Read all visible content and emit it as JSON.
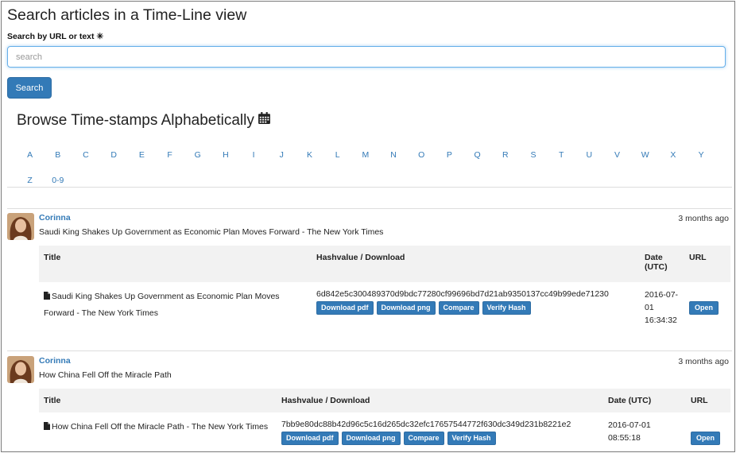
{
  "page_title": "Search articles in a Time-Line view",
  "search": {
    "label": "Search by URL or text ✳",
    "placeholder": "search",
    "value": "",
    "button_label": "Search"
  },
  "browse": {
    "title": "Browse Time-stamps Alphabetically",
    "icon": "calendar-icon",
    "letters_row1": [
      "A",
      "B",
      "C",
      "D",
      "E",
      "F",
      "G",
      "H",
      "I",
      "J",
      "K",
      "L",
      "M",
      "N",
      "O",
      "P",
      "Q",
      "R",
      "S",
      "T",
      "U",
      "V",
      "W",
      "X",
      "Y"
    ],
    "letters_row2": [
      "Z",
      "0-9"
    ]
  },
  "colors": {
    "link": "#337ab7",
    "button": "#337ab7",
    "table_header_bg": "#f2f2f2"
  },
  "entries": [
    {
      "user": "Corinna",
      "headline": "Saudi King Shakes Up Government as Economic Plan Moves Forward - The New York Times",
      "ago": "3 months ago",
      "columns": {
        "title": "Title",
        "hash": "Hashvalue / Download",
        "date": "Date (UTC)",
        "url": "URL"
      },
      "row": {
        "title": "Saudi King Shakes Up Government as Economic Plan Moves Forward - The New York Times",
        "hash": "6d842e5c300489370d9bdc77280cf99696bd7d21ab9350137cc49b99ede71230",
        "date": "2016-07-01 16:34:32",
        "buttons": [
          "Download pdf",
          "Download png",
          "Compare",
          "Verify Hash"
        ],
        "open_label": "Open"
      }
    },
    {
      "user": "Corinna",
      "headline": "How China Fell Off the Miracle Path",
      "ago": "3 months ago",
      "columns": {
        "title": "Title",
        "hash": "Hashvalue / Download",
        "date": "Date (UTC)",
        "url": "URL"
      },
      "row": {
        "title": "How China Fell Off the Miracle Path - The New York Times",
        "hash": "7bb9e80dc88b42d96c5c16d265dc32efc17657544772f630dc349d231b8221e2",
        "date": "2016-07-01 08:55:18",
        "buttons": [
          "Download pdf",
          "Download png",
          "Compare",
          "Verify Hash"
        ],
        "open_label": "Open"
      }
    }
  ]
}
